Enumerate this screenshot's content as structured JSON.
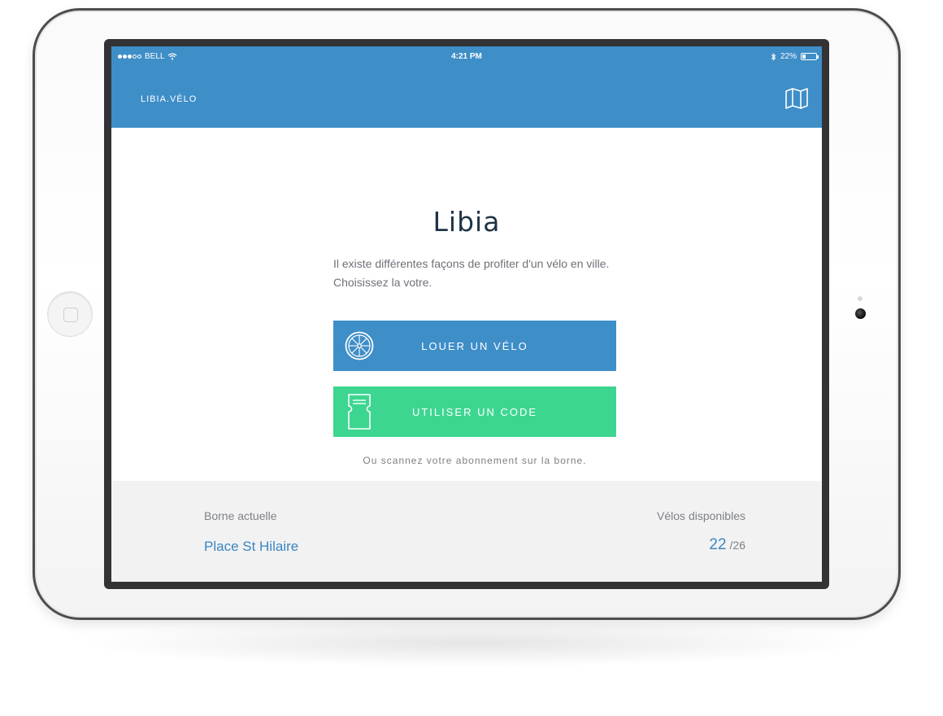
{
  "status_bar": {
    "carrier": "BELL",
    "time": "4:21 PM",
    "battery_text": "22%",
    "battery_level": 0.22
  },
  "nav": {
    "title": "LIBIA.VÉLO",
    "map_icon": "map-icon"
  },
  "main": {
    "title": "Libia",
    "intro": "Il existe différentes façons de profiter d'un vélo en ville. Choisissez la votre.",
    "rent_button": {
      "label": "LOUER UN VÉLO",
      "icon": "bike-wheel-icon",
      "color": "#3e8ec8"
    },
    "code_button": {
      "label": "UTILISER UN CODE",
      "icon": "ticket-icon",
      "color": "#3dd690"
    },
    "scan_note": "Ou scannez votre abonnement sur la borne."
  },
  "footer": {
    "station_label": "Borne actuelle",
    "station_name": "Place St Hilaire",
    "available_label": "Vélos disponibles",
    "available_count": "22",
    "total_count": "/26"
  },
  "colors": {
    "primary": "#3e8ec8",
    "accent": "#3dd690",
    "title": "#1f3346"
  }
}
